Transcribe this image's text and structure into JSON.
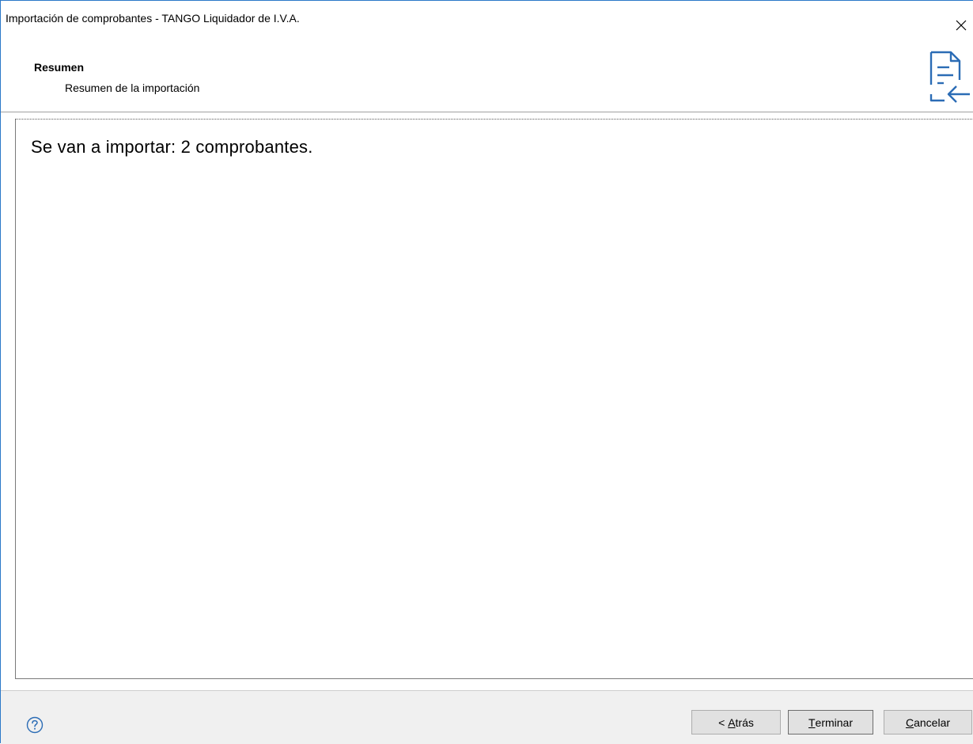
{
  "window": {
    "title": "Importación de comprobantes - TANGO Liquidador de I.V.A.",
    "close_icon": "close-icon",
    "accent_color": "#2b78c8"
  },
  "header": {
    "title": "Resumen",
    "subtitle": "Resumen de la importación",
    "icon": "document-import-icon",
    "icon_color": "#2b6cb5"
  },
  "content": {
    "summary": "Se van a importar: 2 comprobantes."
  },
  "footer": {
    "help_icon": "help-icon",
    "buttons": {
      "back": {
        "prefix": "< ",
        "mnemonic": "A",
        "rest": "trás"
      },
      "finish": {
        "mnemonic": "T",
        "rest": "erminar"
      },
      "cancel": {
        "mnemonic": "C",
        "rest": "ancelar"
      }
    }
  }
}
